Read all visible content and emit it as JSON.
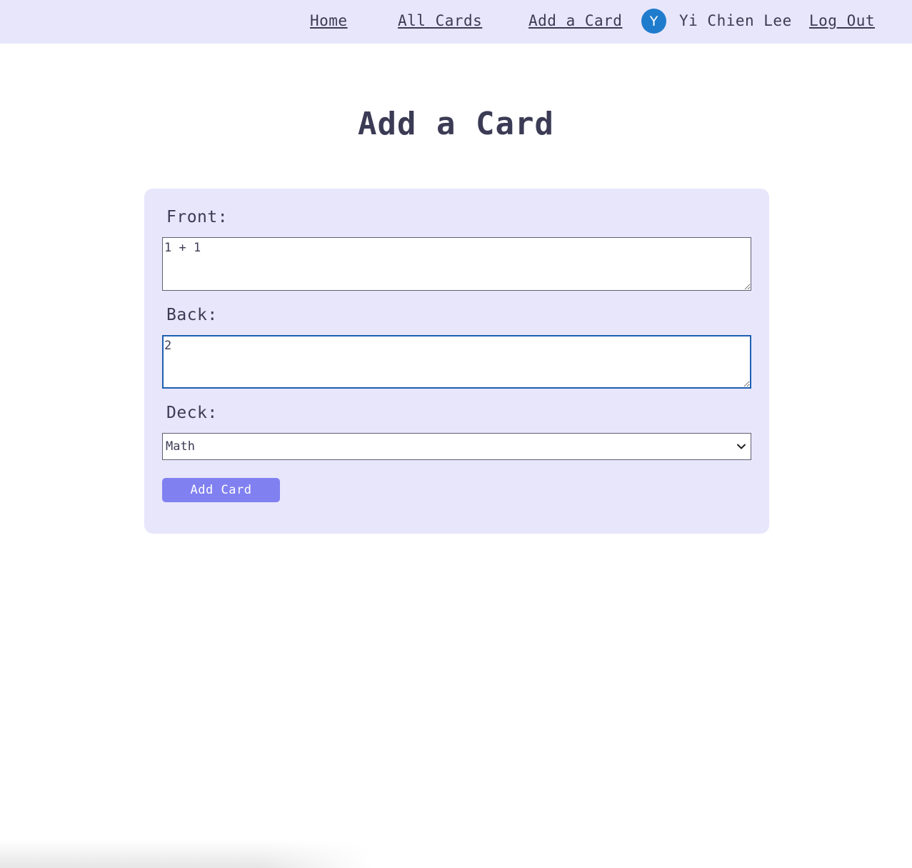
{
  "nav": {
    "home": "Home",
    "all_cards": "All Cards",
    "add_card": "Add a Card",
    "avatar_initial": "Y",
    "user_name": "Yi Chien Lee",
    "log_out": "Log Out"
  },
  "page": {
    "title": "Add a Card"
  },
  "form": {
    "front_label": "Front:",
    "front_value": "1 + 1",
    "back_label": "Back:",
    "back_value": "2",
    "deck_label": "Deck:",
    "deck_selected": "Math",
    "submit_label": "Add Card"
  },
  "colors": {
    "nav_background": "#e8e6fb",
    "card_background": "#e8e6fb",
    "avatar": "#1f7ccd",
    "button": "#8080f0",
    "text": "#3b3b55",
    "focus_border": "#1d5fb0"
  },
  "icons": {
    "select_arrow": "chevron-down-icon"
  }
}
